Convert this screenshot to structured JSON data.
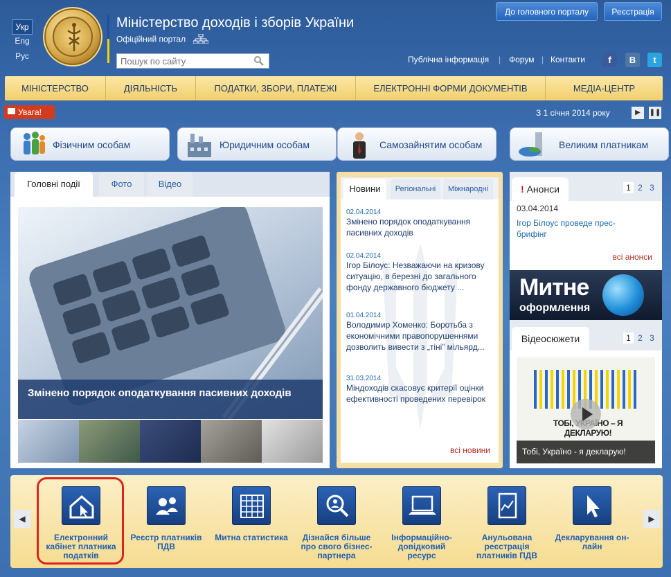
{
  "lang": {
    "ukr": "Укр",
    "eng": "Eng",
    "rus": "Рус"
  },
  "header": {
    "title": "Міністерство доходів і зборів України",
    "subtitle": "Офіційний портал",
    "search_placeholder": "Пошук по сайту"
  },
  "top_buttons": {
    "portal": "До головного порталу",
    "register": "Реєстрація"
  },
  "top_links": {
    "public": "Публічна інформація",
    "forum": "Форум",
    "contacts": "Контакти"
  },
  "social": {
    "fb": "f",
    "vk": "B",
    "tw": "t"
  },
  "menu": [
    "Міністерство",
    "Діяльність",
    "Податки, збори, платежі",
    "Електронні форми документів",
    "Медіа-центр"
  ],
  "alert": {
    "label": "Увага!",
    "ticker": "З 1 січня 2014 року"
  },
  "categories": [
    "Фізичним особам",
    "Юридичним особам",
    "Самозайнятим особам",
    "Великим платникам"
  ],
  "media": {
    "tabs": [
      "Головні події",
      "Фото",
      "Відео"
    ],
    "caption": "Змінено порядок оподаткування пасивних доходів"
  },
  "news": {
    "tabs": [
      "Новини",
      "Регіональні",
      "Міжнародні"
    ],
    "items": [
      {
        "date": "02.04.2014",
        "text": "Змінено порядок оподаткування пасивних доходів"
      },
      {
        "date": "02.04.2014",
        "text": "Ігор Білоус: Незважаючи на кризову ситуацію, в березні до загального фонду державного бюджету ..."
      },
      {
        "date": "01.04.2014",
        "text": "Володимир Хоменко: Боротьба з економічними правопорушеннями дозволить вивести з „тіні” мільярд..."
      },
      {
        "date": "31.03.2014",
        "text": "Міндоходів скасовує критерії оцінки ефективності проведених перевірок"
      }
    ],
    "all": "всі новини"
  },
  "announces": {
    "title": "Анонси",
    "mark": "!",
    "pages": [
      "1",
      "2",
      "3"
    ],
    "date": "03.04.2014",
    "text": "Ігор Білоус проведе прес-брифінг",
    "all": "всі анонси"
  },
  "banner": {
    "line1": "Митне",
    "line2": "оформлення"
  },
  "videos": {
    "title": "Відеосюжети",
    "pages": [
      "1",
      "2",
      "3"
    ],
    "thumb_text": "ТОБІ, УКРАЇНО – Я ДЕКЛАРУЮ!",
    "caption": "Тобі, Україно - я декларую!"
  },
  "services": [
    "Електронний кабінет платника податків",
    "Реєстр платників ПДВ",
    "Митна статистика",
    "Дізнайся більше про свого бізнес-партнера",
    "Інформаційно-довідковий ресурс",
    "Анульована реєстрація платників ПДВ",
    "Декларування он-лайн"
  ]
}
